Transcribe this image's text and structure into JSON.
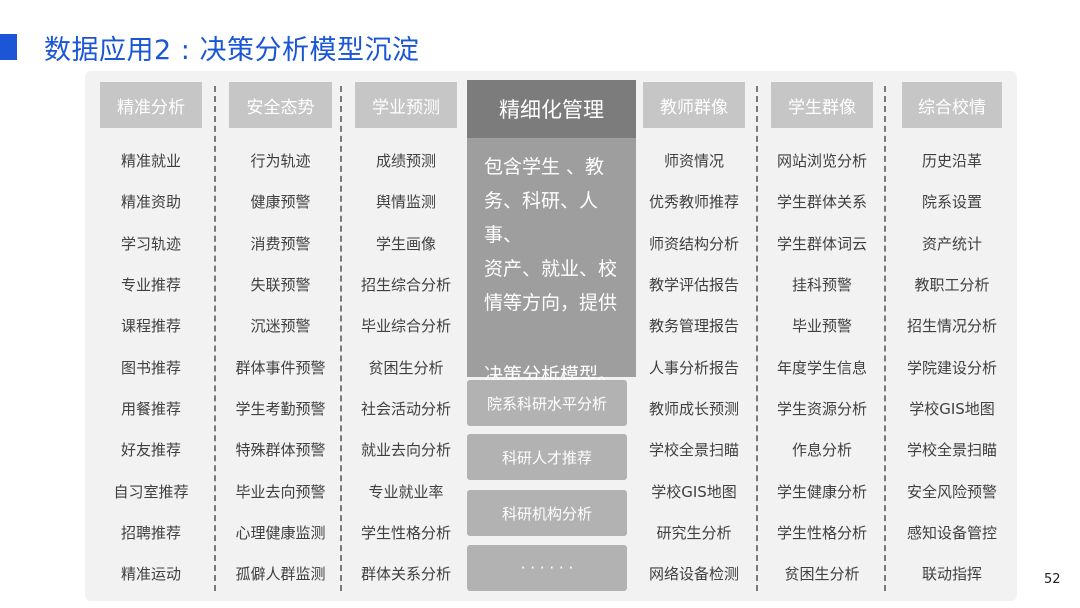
{
  "slide": {
    "title": "数据应用2 : 决策分析模型沉淀",
    "page_number": "52"
  },
  "columns": [
    {
      "header": "精准分析",
      "items": [
        "精准就业",
        "精准资助",
        "学习轨迹",
        "专业推荐",
        "课程推荐",
        "图书推荐",
        "用餐推荐",
        "好友推荐",
        "自习室推荐",
        "招聘推荐",
        "精准运动"
      ]
    },
    {
      "header": "安全态势",
      "items": [
        "行为轨迹",
        "健康预警",
        "消费预警",
        "失联预警",
        "沉迷预警",
        "群体事件预警",
        "学生考勤预警",
        "特殊群体预警",
        "毕业去向预警",
        "心理健康监测",
        "孤僻人群监测"
      ]
    },
    {
      "header": "学业预测",
      "items": [
        "成绩预测",
        "舆情监测",
        "学生画像",
        "招生综合分析",
        "毕业综合分析",
        "贫困生分析",
        "社会活动分析",
        "就业去向分析",
        "专业就业率",
        "学生性格分析",
        "群体关系分析"
      ]
    },
    {
      "header": "教师群像",
      "items": [
        "师资情况",
        "优秀教师推荐",
        "师资结构分析",
        "教学评估报告",
        "教务管理报告",
        "人事分析报告",
        "教师成长预测",
        "学校全景扫瞄",
        "学校GIS地图",
        "研究生分析",
        "网络设备检测"
      ]
    },
    {
      "header": "学生群像",
      "items": [
        "网站浏览分析",
        "学生群体关系",
        "学生群体词云",
        "挂科预警",
        "毕业预警",
        "年度学生信息",
        "学生资源分析",
        "作息分析",
        "学生健康分析",
        "学生性格分析",
        "贫困生分析"
      ]
    },
    {
      "header": "综合校情",
      "items": [
        "历史沿革",
        "院系设置",
        "资产统计",
        "教职工分析",
        "招生情况分析",
        "学院建设分析",
        "学校GIS地图",
        "学校全景扫瞄",
        "安全风险预警",
        "感知设备管控",
        "联动指挥"
      ]
    }
  ],
  "feature": {
    "header": "精细化管理",
    "lines": [
      "包含学生 、教",
      "务、科研、人事、",
      "资产、就业、校",
      "情等方向，提供"
    ],
    "closing": "决策分析模型。",
    "sub_items": [
      "院系科研水平分析",
      "科研人才推荐",
      "科研机构分析",
      "· · · · · ·"
    ]
  }
}
